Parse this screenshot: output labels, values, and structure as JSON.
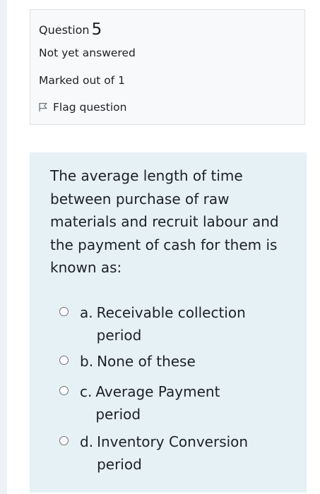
{
  "question_info": {
    "question_label": "Question",
    "question_number": "5",
    "state": "Not yet answered",
    "grade": "Marked out of 1",
    "flag_label": "Flag question"
  },
  "formulation": {
    "question_text": "The average length of time between purchase of raw materials and recruit labour and the payment of cash for them is known as:",
    "options": [
      {
        "letter": "a.",
        "label": "Receivable collection period"
      },
      {
        "letter": "b.",
        "label": "None of these"
      },
      {
        "letter": "c.",
        "label": "Average Payment period"
      },
      {
        "letter": "d.",
        "label": "Inventory Conversion period"
      }
    ]
  },
  "colors": {
    "info_background": "#f8f9fa",
    "info_border": "#dee2e6",
    "formulation_background": "#e6f1f5",
    "text": "#1d2125"
  }
}
